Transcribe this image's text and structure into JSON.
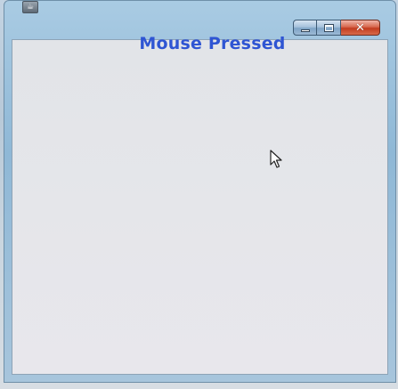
{
  "window": {
    "title": "",
    "buttons": {
      "minimize_icon": "minimize-icon",
      "maximize_icon": "maximize-icon",
      "close_icon": "close-icon",
      "close_glyph": "✕"
    }
  },
  "content": {
    "message": "Mouse Pressed",
    "message_color": "#2f55d3"
  },
  "colors": {
    "client_background": "#e4e5e9",
    "close_button": "#c9462a"
  }
}
